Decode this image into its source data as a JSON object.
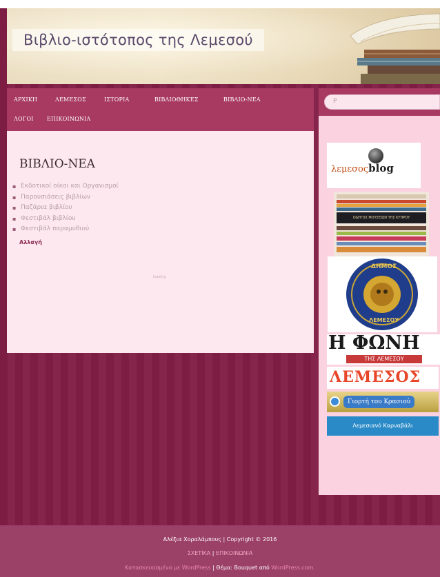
{
  "site": {
    "title": "Βιβλιο-ιστότοπος της Λεμεσού"
  },
  "nav": {
    "items": [
      {
        "label": "ΑΡΧΙΚΗ"
      },
      {
        "label": "ΛΕΜΕΣΟΣ"
      },
      {
        "label": "ΙΣΤΟΡΙΑ"
      },
      {
        "label": "ΒΙΒΛΙΟΘΗΚΕΣ"
      },
      {
        "label": "ΒΙΒΛΙΟ-ΝΕΑ"
      },
      {
        "label": "ΛΟΓΟΙ"
      },
      {
        "label": "ΕΠΙΚΟΙΝΩΝΙΑ"
      }
    ]
  },
  "content": {
    "heading": "ΒΙΒΛΙΟ-ΝΕΑ",
    "categories": [
      "Εκδοτικοί οίκοι και Οργανισμοί",
      "Παρουσιάσεις βιβλίων",
      "Παζάρια βιβλίου",
      "Φεστιβάλ βιβλίου",
      "Φεστιβάλ παραμυθιού"
    ],
    "change_label": "Αλλαγή",
    "loading_text": "loading"
  },
  "sidebar": {
    "search_placeholder": "P",
    "widgets": {
      "blog": {
        "prefix": "λεμεσος",
        "suffix": "blog"
      },
      "museum_caption": "ΟΔΗΓΟΣ ΜΟΥΣΕΙΩΝ ΤΗΣ ΚΥΠΡΟΥ",
      "seal": {
        "top": "ΔΗΜΟΣ",
        "bottom": "ΛΕΜΕΣΟΥ"
      },
      "foni": {
        "title": "Η ΦΩΝΗ",
        "subtitle": "ΤΗΣ ΛΕΜΕΣΟΥ"
      },
      "lemesos_text": "ΛΕΜΕΣΟΣ",
      "wine": "Γιορτή του Κρασιού",
      "carnival": "Λεμεσιανό Καρναβάλι"
    }
  },
  "footer": {
    "line1": "Αλέξια Χοραλάμπους | Copyright © 2016",
    "about": "ΣΧΕΤΙΚΑ",
    "contact": "ΕΠΙΚΟΙΝΩΝΙΑ",
    "powered": "Κατασκευασμένο με WordPress",
    "theme_prefix": "Θέμα: Bouquet από",
    "theme_link": "WordPress.com."
  },
  "colors": {
    "nav_bg": "#a83a61",
    "content_bg": "#fde8ef",
    "sidebar_bg": "#fbd2df",
    "page_bg": "#7d1d44"
  }
}
